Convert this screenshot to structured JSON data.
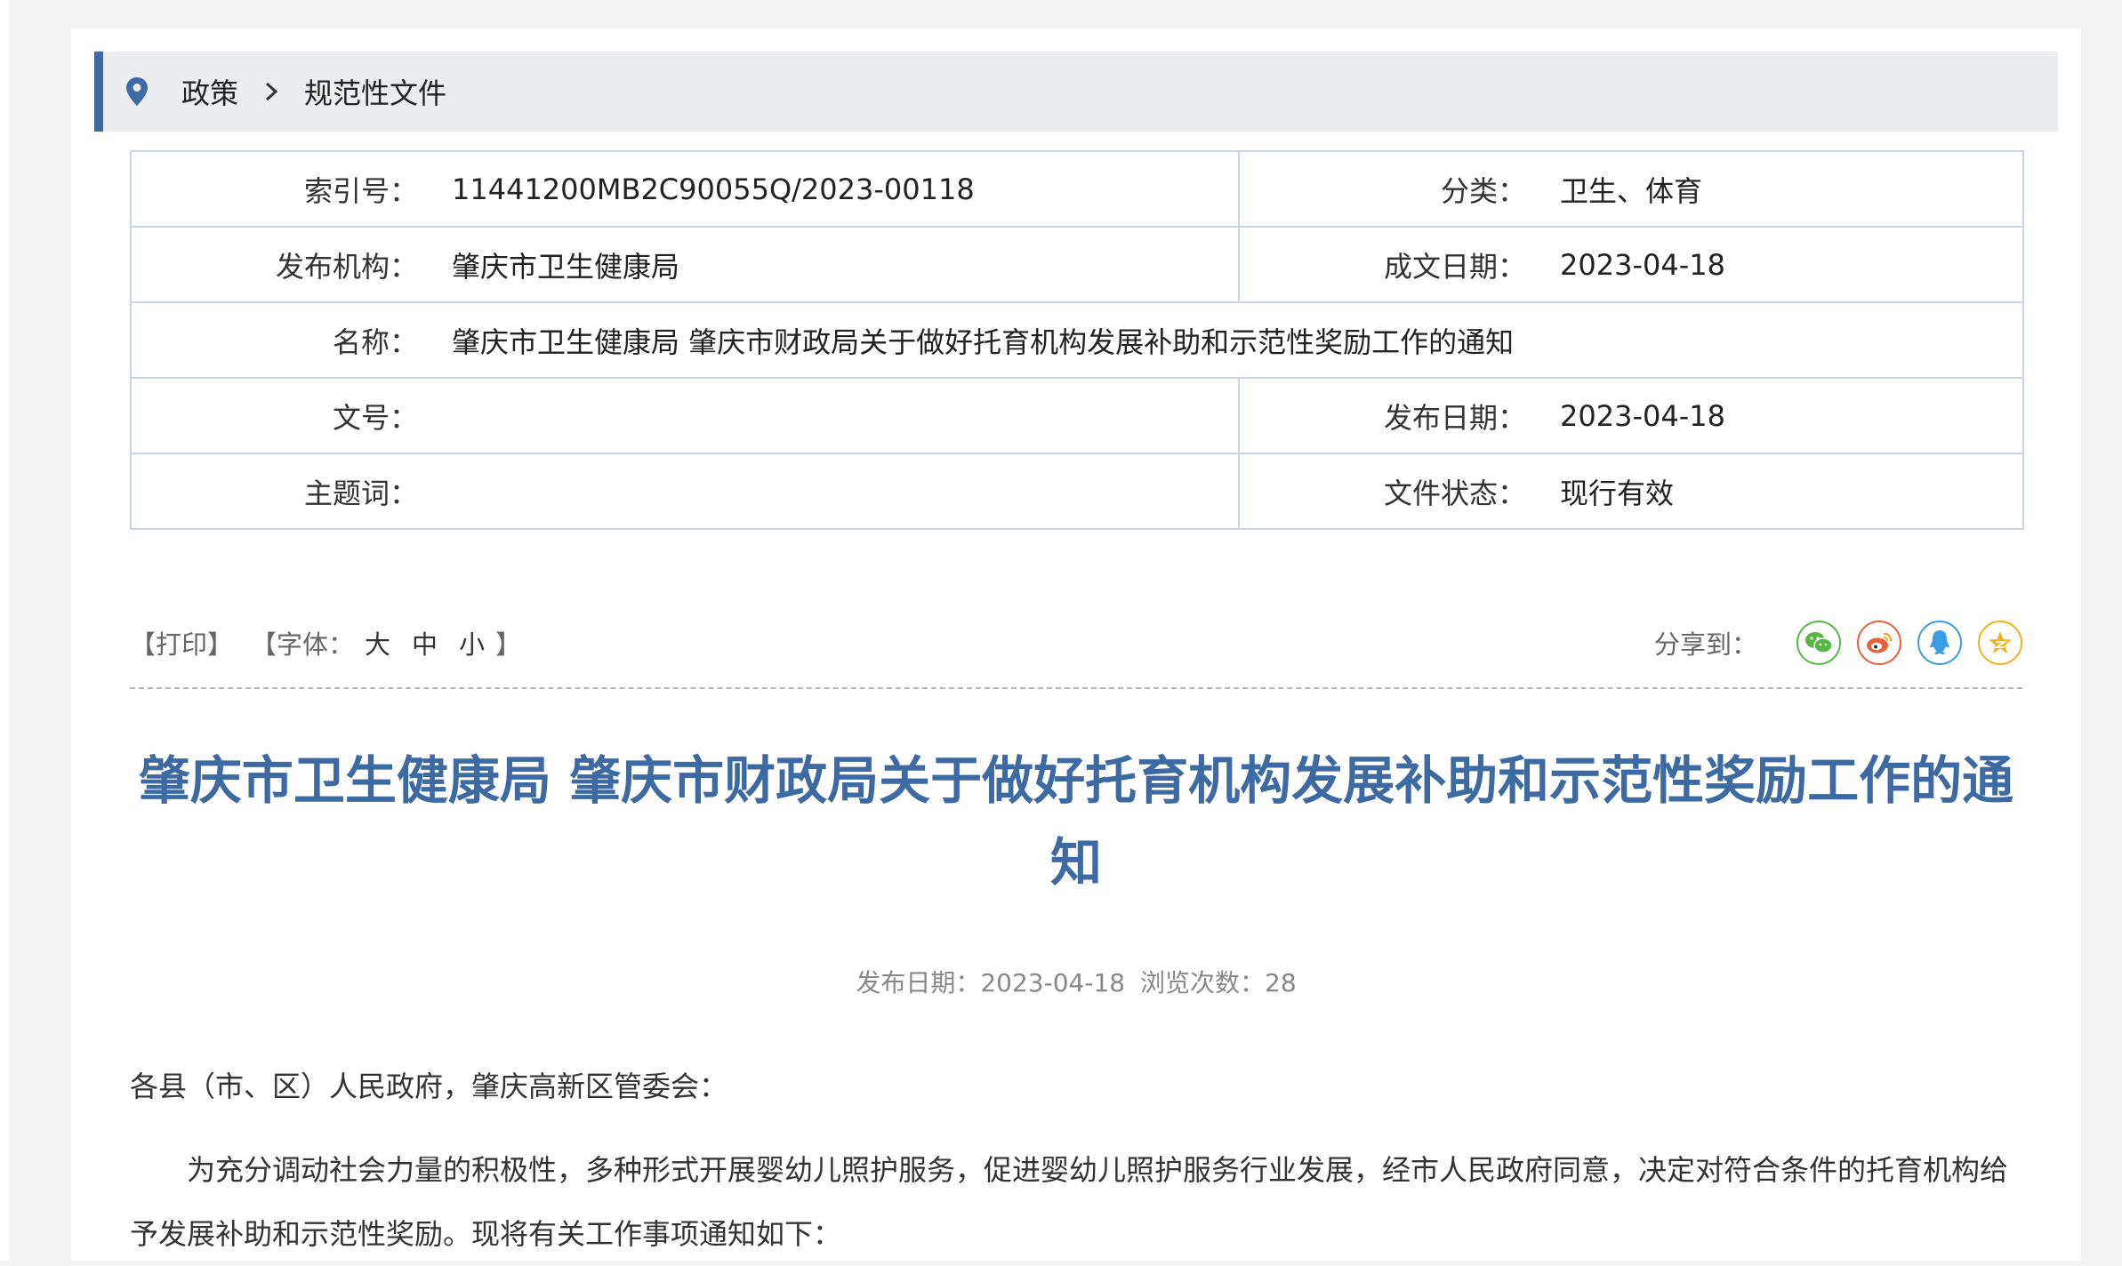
{
  "breadcrumb": {
    "items": [
      "政策",
      "规范性文件"
    ]
  },
  "meta": {
    "index_label": "索引号：",
    "index_value": "11441200MB2C90055Q/2023-00118",
    "category_label": "分类：",
    "category_value": "卫生、体育",
    "publisher_label": "发布机构：",
    "publisher_value": "肇庆市卫生健康局",
    "written_date_label": "成文日期：",
    "written_date_value": "2023-04-18",
    "name_label": "名称：",
    "name_value": "肇庆市卫生健康局 肇庆市财政局关于做好托育机构发展补助和示范性奖励工作的通知",
    "doc_no_label": "文号：",
    "doc_no_value": "",
    "publish_date_label": "发布日期：",
    "publish_date_value": "2023-04-18",
    "keywords_label": "主题词：",
    "keywords_value": "",
    "status_label": "文件状态：",
    "status_value": "现行有效"
  },
  "toolbar": {
    "print_label": "【打印】",
    "font_prefix": "【字体：",
    "font_large": "大",
    "font_medium": "中",
    "font_small": "小",
    "font_suffix": "】",
    "share_label": "分享到：",
    "share_icons": [
      "wechat-icon",
      "weibo-icon",
      "qq-icon",
      "qzone-icon"
    ]
  },
  "article": {
    "title": "肇庆市卫生健康局 肇庆市财政局关于做好托育机构发展补助和示范性奖励工作的通知",
    "meta_date": "发布日期：2023-04-18",
    "meta_views": "浏览次数：28",
    "salutation": "各县（市、区）人民政府，肇庆高新区管委会：",
    "paragraph1": "为充分调动社会力量的积极性，多种形式开展婴幼儿照护服务，促进婴幼儿照护服务行业发展，经市人民政府同意，决定对符合条件的托育机构给予发展补助和示范性奖励。现将有关工作事项通知如下："
  },
  "colors": {
    "accent": "#3d6aa3",
    "breadcrumb_bg": "#ebedf1",
    "table_border": "#c7d5e5",
    "wechat": "#57b845",
    "weibo": "#e8623a",
    "qq": "#3a9be6",
    "qzone": "#f2b21e"
  }
}
